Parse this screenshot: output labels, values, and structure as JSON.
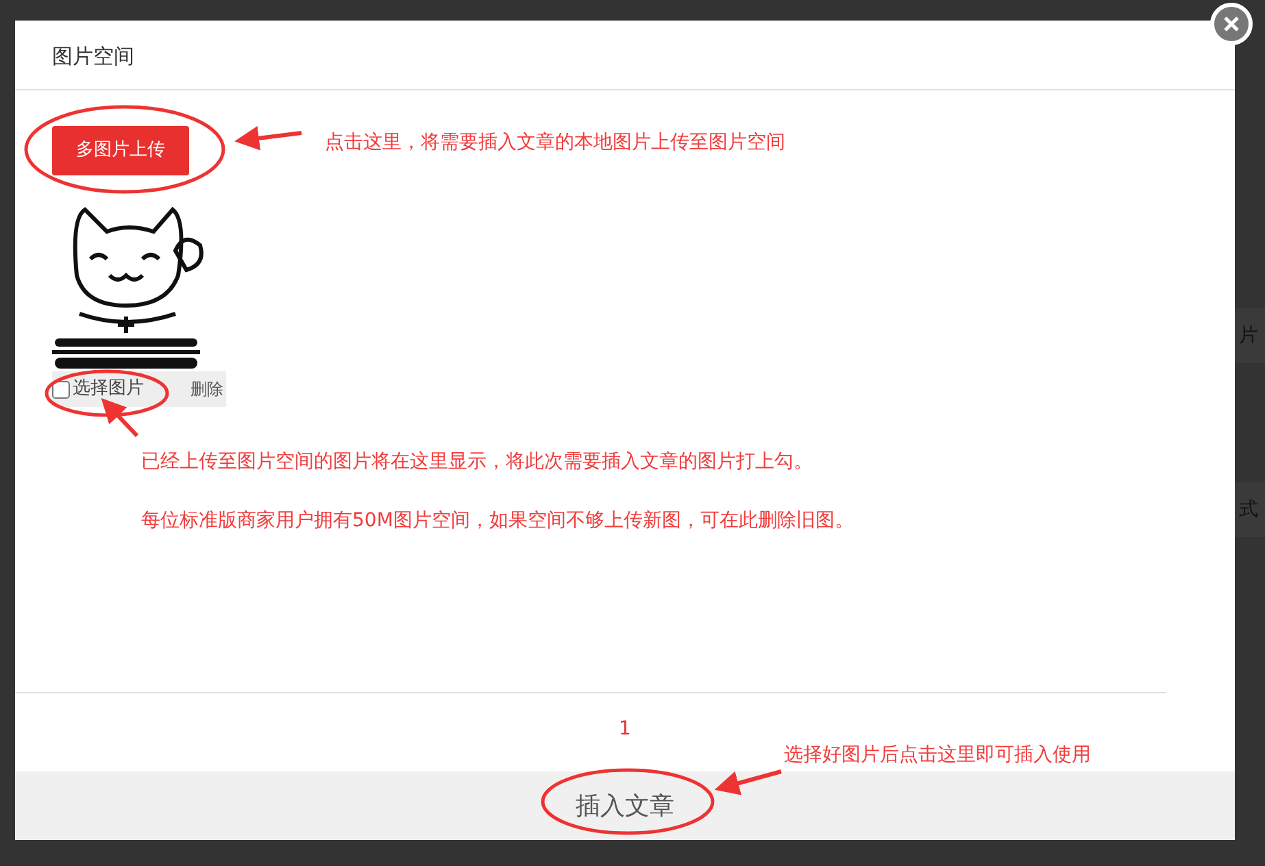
{
  "background_text": [
    "片",
    "式"
  ],
  "dialog": {
    "title": "图片空间",
    "upload_button": "多图片上传",
    "images": [
      {
        "select_label": "选择图片",
        "checked": false,
        "delete_label": "删除"
      }
    ],
    "pagination": [
      {
        "label": "1",
        "selected": true
      }
    ],
    "insert_button": "插入文章"
  },
  "annotations": [
    "点击这里，将需要插入文章的本地图片上传至图片空间",
    "已经上传至图片空间的图片将在这里显示，将此次需要插入文章的图片打上勾。",
    "每位标准版商家用户拥有50M图片空间，如果空间不够上传新图，可在此删除旧图。",
    "选择好图片后点击这里即可插入使用"
  ]
}
